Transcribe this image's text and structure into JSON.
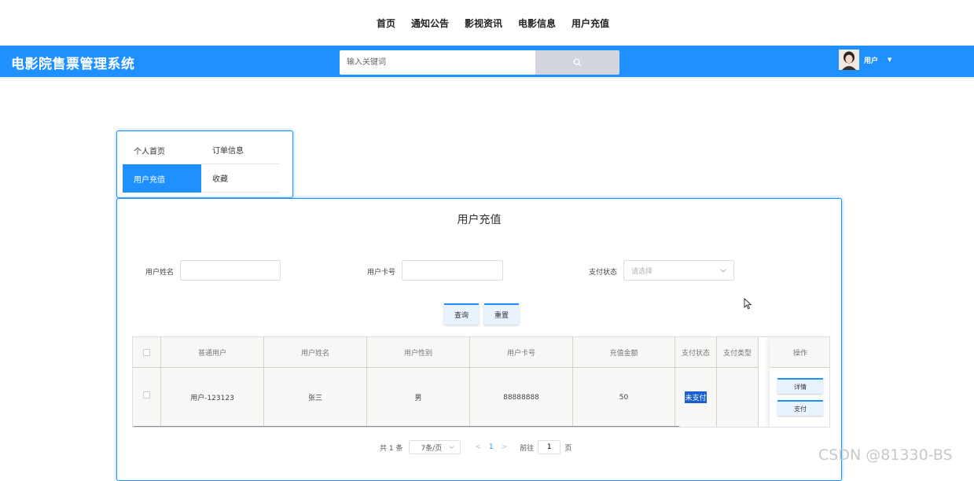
{
  "topnav": {
    "items": [
      "首页",
      "通知公告",
      "影视资讯",
      "电影信息",
      "用户充值"
    ]
  },
  "header": {
    "brand": "电影院售票管理系统",
    "search_placeholder": "输入关键词",
    "user_label": "用户"
  },
  "side_menu": {
    "items": [
      "个人首页",
      "订单信息",
      "用户充值",
      "收藏"
    ],
    "active": "用户充值"
  },
  "page": {
    "title": "用户充值",
    "filters": {
      "name_label": "用户姓名",
      "card_label": "用户卡号",
      "status_label": "支付状态",
      "status_placeholder": "请选择"
    },
    "buttons": {
      "query": "查询",
      "reset": "重置"
    }
  },
  "table": {
    "headers": [
      "普通用户",
      "用户姓名",
      "用户性别",
      "用户卡号",
      "充值金额",
      "支付状态",
      "支付类型",
      "操作"
    ],
    "rows": [
      {
        "user": "用户-123123",
        "name": "张三",
        "gender": "男",
        "card": "88888888",
        "amount": "50",
        "status": "未支付",
        "type": ""
      }
    ],
    "row_actions": [
      "详情",
      "支付"
    ]
  },
  "pagination": {
    "total": "共 1 条",
    "page_size": "7条/页",
    "current_page": "1",
    "goto_label": "前往",
    "goto_value": "1",
    "page_suffix": "页"
  },
  "watermark": "CSDN @81330-BS",
  "colors": {
    "primary": "#1e90ff",
    "badge": "#1a5fd0"
  }
}
